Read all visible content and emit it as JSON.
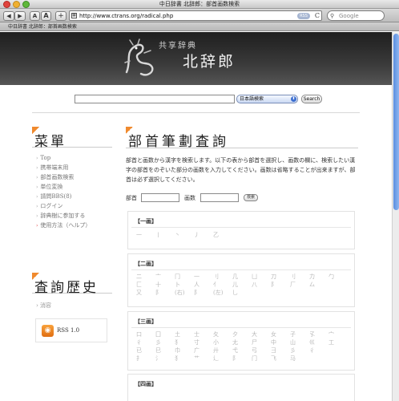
{
  "window": {
    "title": "中日辞書 北辞郎：部首画数検索"
  },
  "toolbar": {
    "back": "◀",
    "forward": "▶",
    "text_smaller": "A",
    "text_bigger": "A",
    "add": "+",
    "url": "http://www.ctrans.org/radical.php",
    "rss": "RSS",
    "reload": "C",
    "search_placeholder": "Google"
  },
  "tab": {
    "label": "中日辞書 北辞郎：部首画数検索"
  },
  "site": {
    "logo_small": "共享辞典",
    "logo_big": "北辞郎"
  },
  "search": {
    "dictionary": "日本語検索",
    "button": "Search"
  },
  "sidebar": {
    "menu_title": "菜單",
    "items": [
      {
        "label": "Top",
        "active": false
      },
      {
        "label": "携帯端末用",
        "active": false
      },
      {
        "label": "部首画数検索",
        "active": false
      },
      {
        "label": "単位変換",
        "active": false
      },
      {
        "label": "請問BBS(8)",
        "active": false
      },
      {
        "label": "ログイン",
        "active": false
      },
      {
        "label": "辞典樹に参加する",
        "active": false
      },
      {
        "label": "使用方法（ヘルプ）",
        "active": true
      }
    ],
    "history_title": "査詢歴史",
    "history_item": "消容",
    "rss_label": "RSS 1.0"
  },
  "main": {
    "title": "部首筆劃査詢",
    "description": "部首と画数から漢字を検索します。以下の表から部首を選択し、画数の欄に、検索したい漢字の部首をのぞいた部分の画数を入力してください。画数は省略することが出来ますが、部首は必ず選択してください。",
    "form": {
      "radical_label": "部首",
      "strokes_label": "画数",
      "button": "検索"
    },
    "groups": [
      {
        "title": "【一画】",
        "rows": [
          [
            "一",
            "丨",
            "丶",
            "丿",
            "乙"
          ]
        ]
      },
      {
        "title": "【二画】",
        "rows": [
          [
            "二",
            "亠",
            "冂",
            "一",
            "刂",
            "几",
            "凵",
            "刀",
            "刂",
            "力",
            "勹"
          ],
          [
            "匚",
            "十",
            "卜",
            "人",
            "亻",
            "儿",
            "八",
            "阝",
            "厂",
            "厶"
          ],
          [
            "又",
            "阝",
            "(右)",
            "阝",
            "(左)",
            "乚"
          ]
        ]
      },
      {
        "title": "【三画】",
        "rows": [
          [
            "口",
            "囗",
            "土",
            "士",
            "夂",
            "夕",
            "大",
            "女",
            "子",
            "孓",
            "宀"
          ],
          [
            "彳",
            "彡",
            "犭",
            "寸",
            "小",
            "尢",
            "尸",
            "中",
            "山",
            "巛",
            "工"
          ],
          [
            "已",
            "巳",
            "巾",
            "广",
            "廾",
            "弋",
            "弓",
            "彐",
            "彡",
            "彳"
          ],
          [
            "扌",
            "氵",
            "犭",
            "艹",
            "辶",
            "阝",
            "门",
            "飞",
            "马"
          ]
        ]
      },
      {
        "title": "【四画】",
        "rows": []
      }
    ]
  },
  "colors": {
    "accent": "#f08a2e",
    "banner": "#2a2a2a",
    "link": "#777777"
  }
}
